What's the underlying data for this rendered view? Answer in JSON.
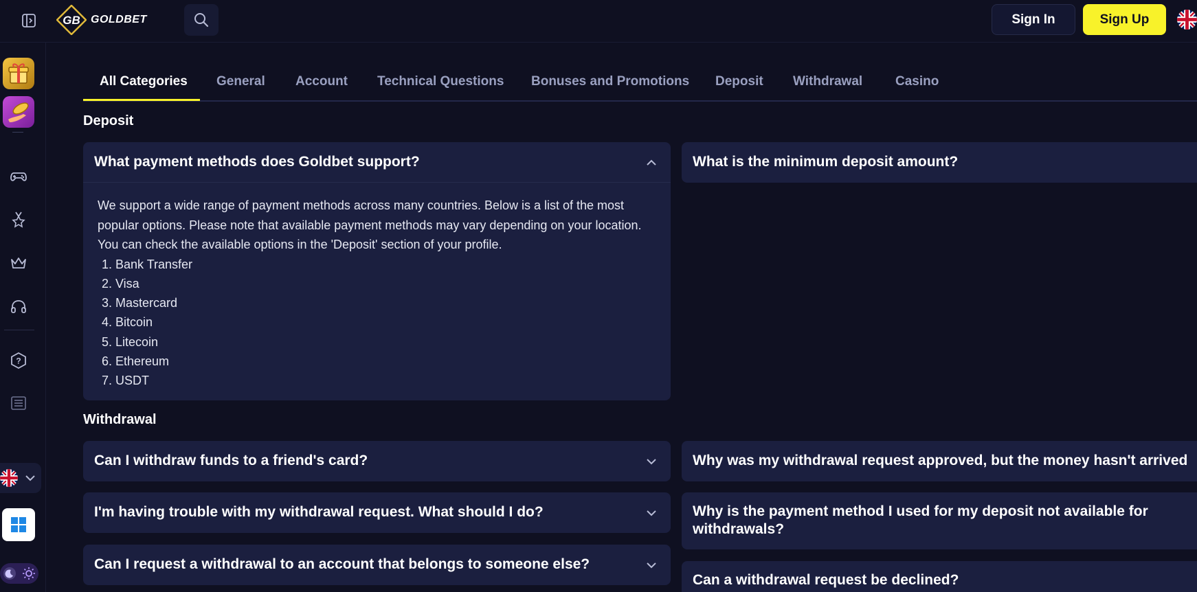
{
  "header": {
    "brand_name": "GOLDBET",
    "brand_mark": "GB",
    "signin_label": "Sign In",
    "signup_label": "Sign Up"
  },
  "colors": {
    "background": "#0f1021",
    "card": "#1b1f3f",
    "accent": "#f8f22a",
    "muted_text": "#9aa0c0"
  },
  "sidebar": {
    "icons": [
      "gift-promo-icon",
      "hand-coin-promo-icon",
      "gamepad-icon",
      "medal-icon",
      "crown-icon",
      "headset-icon",
      "help-icon",
      "list-icon",
      "uk-flag-icon",
      "windows-icon",
      "moon-icon",
      "sun-icon"
    ]
  },
  "tabs": [
    {
      "label": "All Categories",
      "active": true
    },
    {
      "label": "General"
    },
    {
      "label": "Account"
    },
    {
      "label": "Technical Questions"
    },
    {
      "label": "Bonuses and Promotions"
    },
    {
      "label": "Deposit"
    },
    {
      "label": "Withdrawal"
    },
    {
      "label": "Casino"
    }
  ],
  "sections": {
    "deposit": {
      "title": "Deposit",
      "items": [
        {
          "question": "What payment methods does Goldbet support?",
          "expanded": true,
          "answer": "We support a wide range of payment methods across many countries. Below is a list of the most popular options. Please note that available payment methods may vary depending on your location. You can check the available options in the 'Deposit' section of your profile.",
          "methods": [
            "Bank Transfer",
            "Visa",
            "Mastercard",
            "Bitcoin",
            "Litecoin",
            "Ethereum",
            "USDT"
          ]
        },
        {
          "question": "What is the minimum deposit amount?",
          "expanded": false
        }
      ]
    },
    "withdrawal": {
      "title": "Withdrawal",
      "items": [
        {
          "question": "Can I withdraw funds to a friend's card?"
        },
        {
          "question": "Why was my withdrawal request approved, but the money hasn't arrived"
        },
        {
          "question": "I'm having trouble with my withdrawal request. What should I do?"
        },
        {
          "question": "Why is the payment method I used for my deposit not available for withdrawals?"
        },
        {
          "question": "Can I request a withdrawal to an account that belongs to someone else?"
        },
        {
          "question": "Can a withdrawal request be declined?"
        }
      ]
    }
  }
}
